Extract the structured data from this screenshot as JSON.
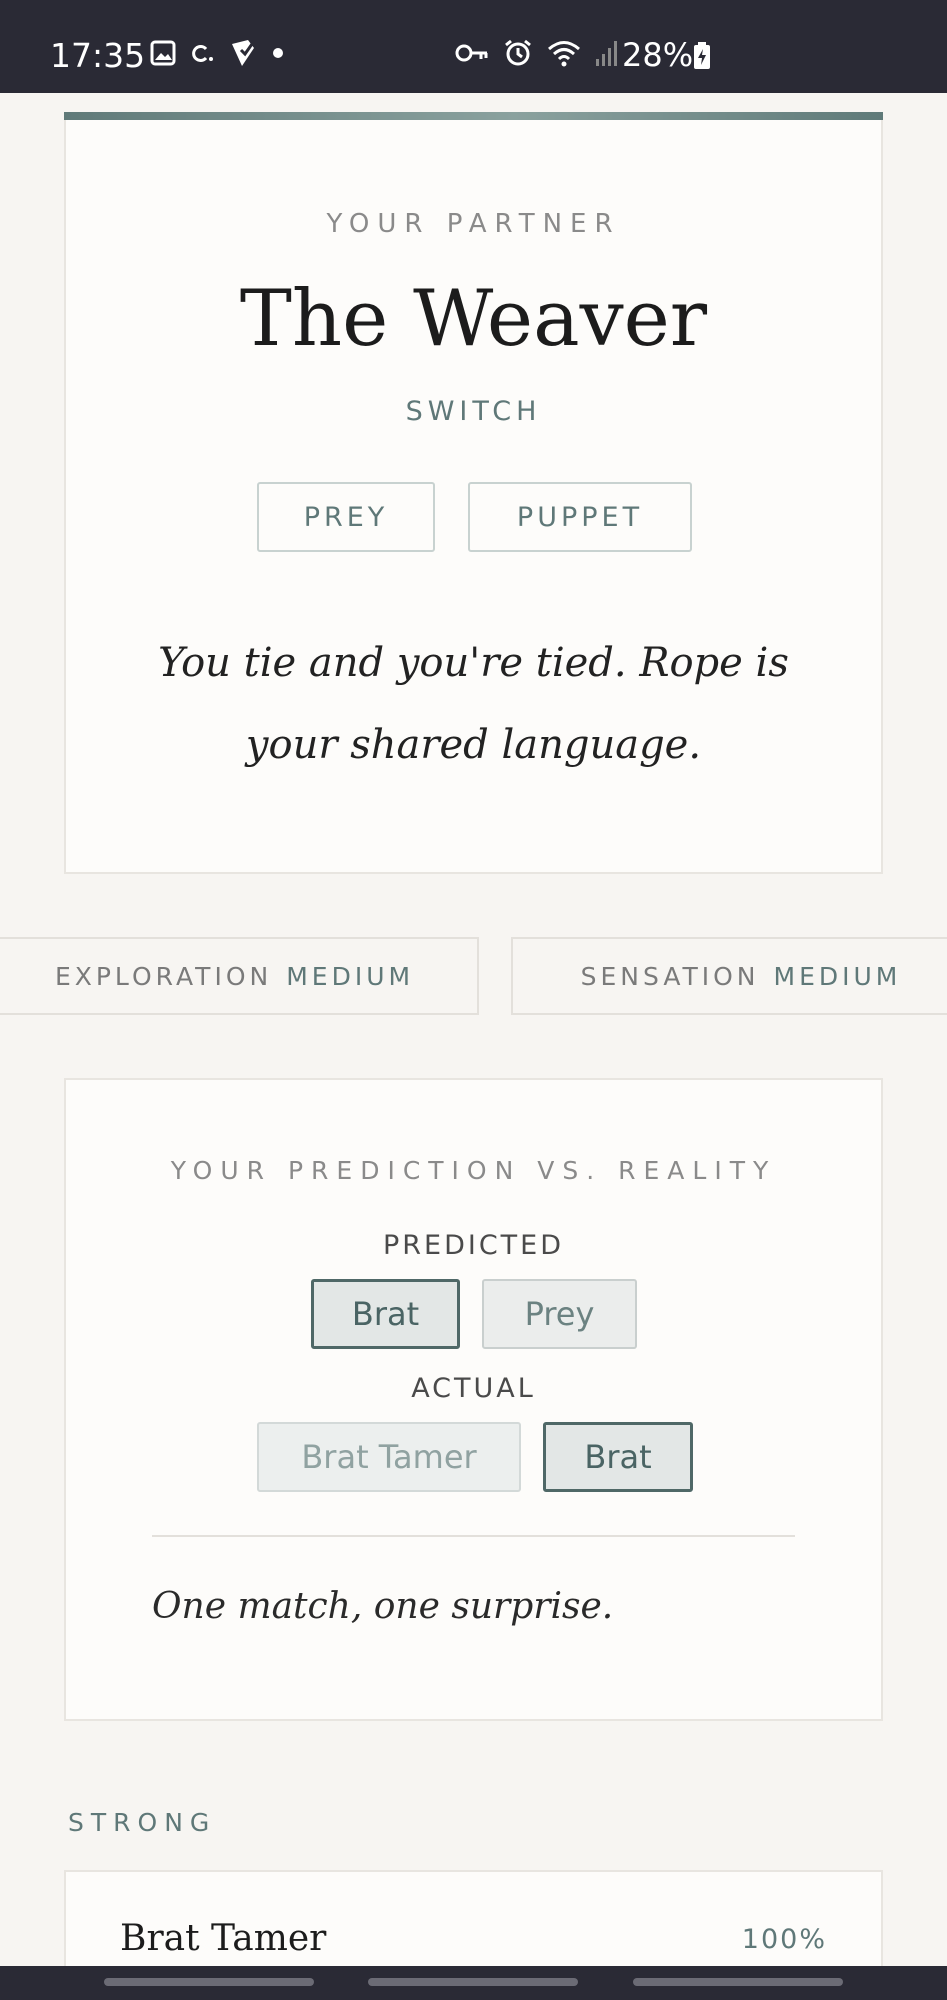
{
  "status_bar": {
    "time": "17:35",
    "battery": "28%",
    "left_icons": [
      "image-icon",
      "c-icon",
      "shield-check-icon",
      "dot-icon"
    ],
    "right_icons": [
      "key-icon",
      "alarm-icon",
      "wifi-icon",
      "signal-icon",
      "battery-icon"
    ]
  },
  "partner": {
    "eyebrow": "YOUR PARTNER",
    "name": "The Weaver",
    "role": "SWITCH",
    "tags": [
      "PREY",
      "PUPPET"
    ],
    "description": "You tie and you're tied. Rope is your shared language."
  },
  "dimensions": [
    {
      "label": "EXPLORATION",
      "level": "MEDIUM"
    },
    {
      "label": "SENSATION",
      "level": "MEDIUM"
    }
  ],
  "prediction": {
    "eyebrow": "YOUR PREDICTION VS. REALITY",
    "predicted_label": "PREDICTED",
    "predicted": [
      "Brat",
      "Prey"
    ],
    "actual_label": "ACTUAL",
    "actual": [
      "Brat Tamer",
      "Brat"
    ],
    "verdict": "One match, one surprise."
  },
  "strong": {
    "title": "STRONG",
    "items": [
      {
        "name": "Brat Tamer",
        "percent": "100%"
      }
    ]
  },
  "colors": {
    "accent": "#5f7878",
    "background": "#f7f5f2",
    "card": "#fdfcfa",
    "status_bar": "#2a2a35"
  }
}
